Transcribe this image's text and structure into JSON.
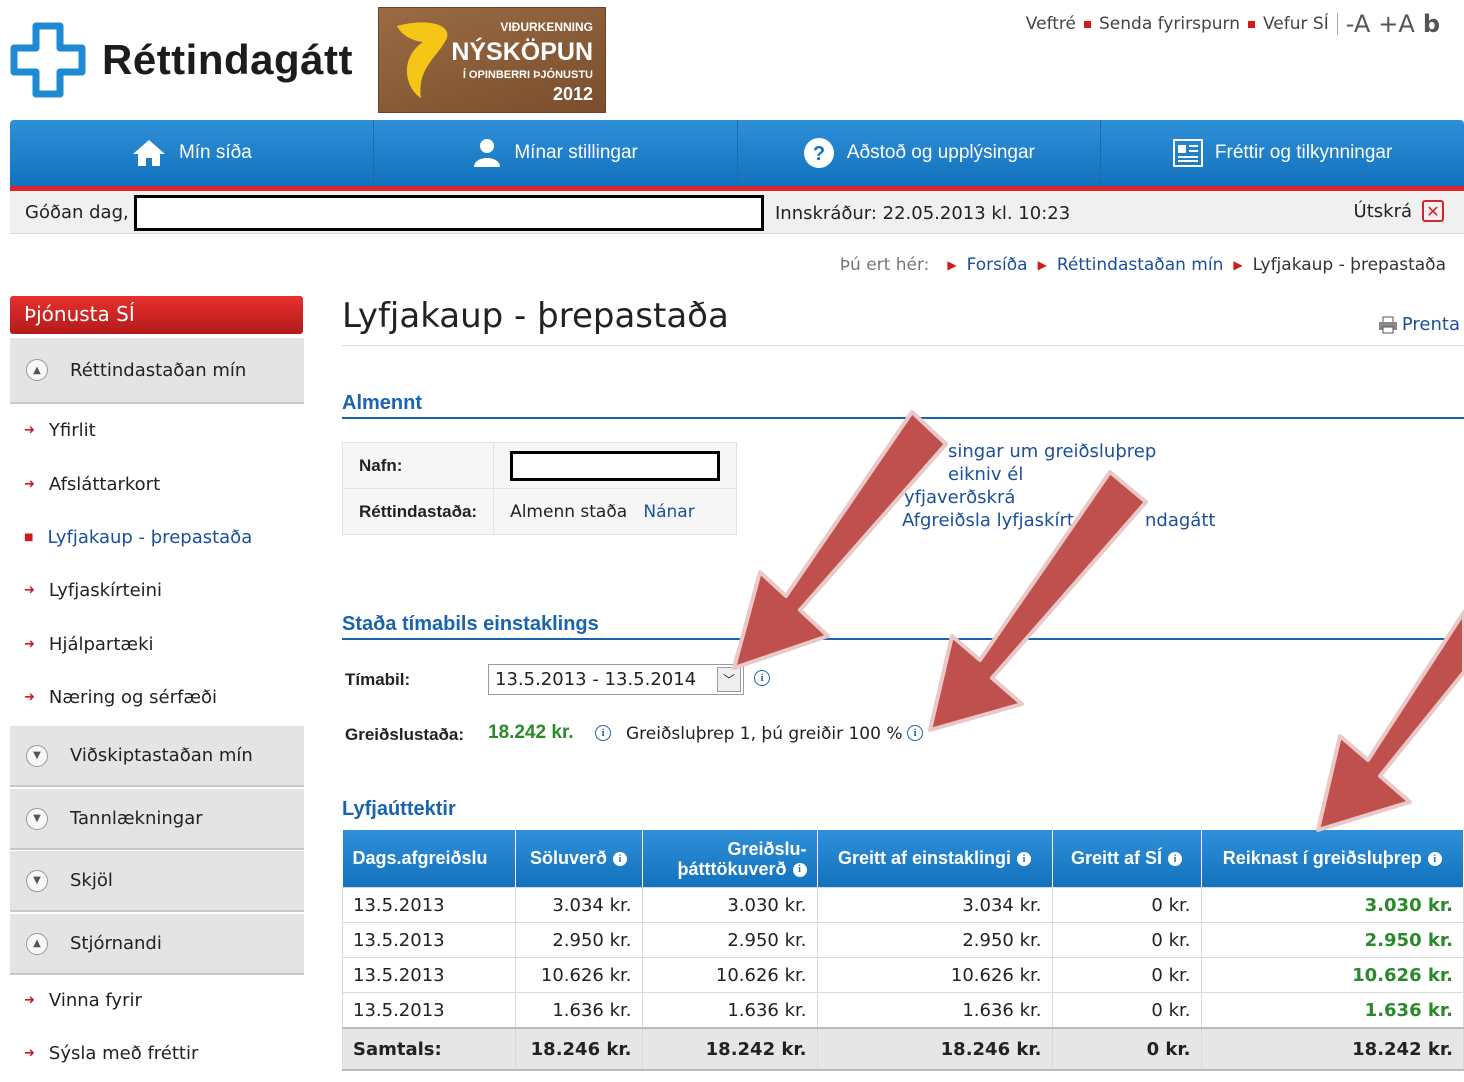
{
  "header": {
    "brand": "Réttindagátt",
    "award": {
      "line1": "VIÐURKENNING",
      "line2": "NÝSKÖPUN",
      "line3": "Í OPINBERRI ÞJÓNUSTU",
      "line4": "2012"
    },
    "top_links": {
      "sitemap": "Veftré",
      "send_question": "Senda fyrirspurn",
      "web": "Vefur SÍ",
      "decrease": "-A",
      "increase": "+A",
      "contrast": "b"
    }
  },
  "nav": {
    "items": [
      {
        "label": "Mín síða",
        "icon": "home-icon"
      },
      {
        "label": "Mínar stillingar",
        "icon": "user-icon"
      },
      {
        "label": "Aðstoð og upplýsingar",
        "icon": "help-icon"
      },
      {
        "label": "Fréttir og tilkynningar",
        "icon": "news-icon"
      }
    ]
  },
  "welcome": {
    "greeting": "Góðan dag,",
    "login_info": "Innskráður: 22.05.2013 kl. 10:23",
    "logout": "Útskrá"
  },
  "breadcrumb": {
    "label": "Þú ert hér:",
    "items": [
      "Forsíða",
      "Réttindastaðan mín",
      "Lyfjakaup - þrepastaða"
    ]
  },
  "sidebar": {
    "heading": "Þjónusta SÍ",
    "section1": "Réttindastaðan mín",
    "links1": [
      "Yfirlit",
      "Afsláttarkort",
      "Lyfjakaup - þrepastaða",
      "Lyfjaskírteini",
      "Hjálpartæki",
      "Næring og sérfæði"
    ],
    "sections": [
      "Viðskiptastaðan mín",
      "Tannlækningar",
      "Skjöl",
      "Stjórnandi"
    ],
    "links2": [
      "Vinna fyrir",
      "Sýsla með fréttir"
    ]
  },
  "main": {
    "title": "Lyfjakaup - þrepastaða",
    "print": "Prenta",
    "general": {
      "heading": "Almennt",
      "name_label": "Nafn:",
      "status_label": "Réttindastaða:",
      "status_value": "Almenn staða",
      "more_link": "Nánar"
    },
    "side_links": [
      "singar um greiðsluþrep",
      "eikniv él",
      "yfjaverðskrá",
      "Afgreiðsla lyfjaskírte",
      "ndagátt"
    ],
    "period": {
      "heading": "Staða tímabils einstaklings",
      "period_label": "Tímabil:",
      "period_value": "13.5.2013 - 13.5.2014",
      "payment_label": "Greiðslustaða:",
      "payment_amount": "18.242 kr.",
      "payment_text": "Greiðsluþrep 1, þú greiðir 100 %"
    },
    "purchases": {
      "heading": "Lyfjaúttektir",
      "columns": [
        "Dags.afgreiðslu",
        "Söluverð",
        "Greiðslu-\nþátttökuverð",
        "Greitt af einstaklingi",
        "Greitt af SÍ",
        "Reiknast í greiðsluþrep"
      ],
      "rows": [
        [
          "13.5.2013",
          "3.034 kr.",
          "3.030 kr.",
          "3.034 kr.",
          "0 kr.",
          "3.030 kr."
        ],
        [
          "13.5.2013",
          "2.950 kr.",
          "2.950 kr.",
          "2.950 kr.",
          "0 kr.",
          "2.950 kr."
        ],
        [
          "13.5.2013",
          "10.626 kr.",
          "10.626 kr.",
          "10.626 kr.",
          "0 kr.",
          "10.626 kr."
        ],
        [
          "13.5.2013",
          "1.636 kr.",
          "1.636 kr.",
          "1.636 kr.",
          "0 kr.",
          "1.636 kr."
        ]
      ],
      "total": [
        "Samtals:",
        "18.246 kr.",
        "18.242 kr.",
        "18.246 kr.",
        "0 kr.",
        "18.242 kr."
      ]
    }
  },
  "colors": {
    "brand_blue": "#1a63ad",
    "nav_red": "#d8252b",
    "money_green": "#2a8a2a",
    "arrow_red": "#c0504d"
  }
}
